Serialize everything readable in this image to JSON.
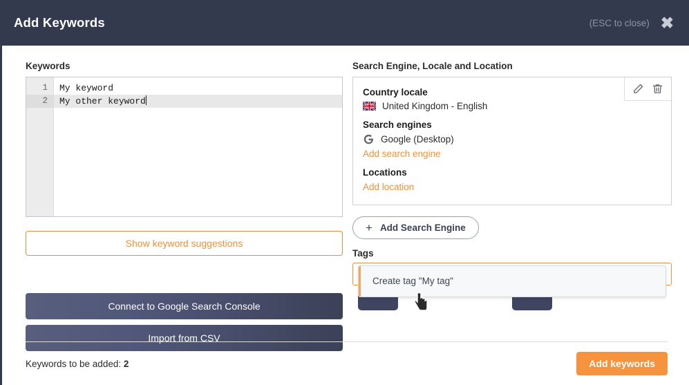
{
  "header": {
    "title": "Add Keywords",
    "esc_hint": "(ESC to close)",
    "close_icon": "close-icon",
    "bg_color": "#343a4d"
  },
  "keywords_panel": {
    "label": "Keywords",
    "lines": [
      {
        "number": "1",
        "text": "My keyword",
        "active": false
      },
      {
        "number": "2",
        "text": "My other keyword",
        "active": true
      }
    ],
    "suggestions_button": "Show keyword suggestions",
    "gsc_button": "Connect to Google Search Console",
    "csv_button": "Import from CSV"
  },
  "engine_panel": {
    "label": "Search Engine, Locale and Location",
    "card": {
      "edit_icon": "pencil-icon",
      "delete_icon": "trash-icon",
      "country_locale_title": "Country locale",
      "country_locale_value": "United Kingdom - English",
      "country_flag_icon": "union-jack-flag-icon",
      "search_engines_title": "Search engines",
      "search_engine_value": "Google (Desktop)",
      "search_engine_icon": "google-logo-icon",
      "add_search_engine_link": "Add search engine",
      "locations_title": "Locations",
      "add_location_link": "Add location"
    },
    "add_engine_button": "Add Search Engine",
    "add_engine_icon": "plus-icon"
  },
  "tags": {
    "label": "Tags",
    "value": "My tag",
    "placeholder": "My tag",
    "chevron_icon": "chevron-up-down-icon",
    "dropdown_option": "Create tag \"My tag\"",
    "focus_color": "#ed9240"
  },
  "footer": {
    "count_label": "Keywords to be added:",
    "count_value": "2",
    "submit_button": "Add keywords",
    "accent_color": "#f5933f"
  },
  "cursor": {
    "icon": "pointing-hand-cursor"
  }
}
